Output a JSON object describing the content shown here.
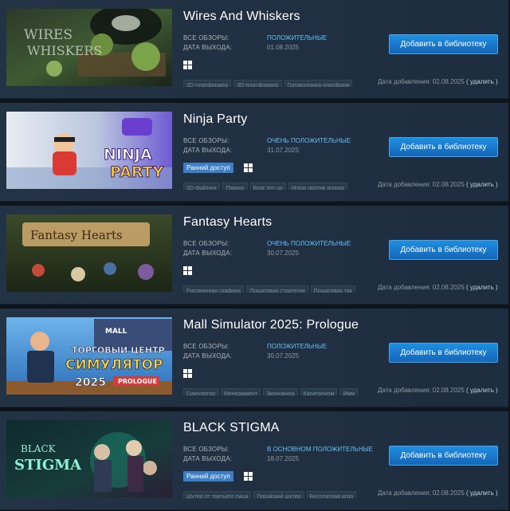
{
  "labels": {
    "reviews": "ВСЕ ОБЗОРЫ:",
    "release": "ДАТА ВЫХОДА:",
    "add_button": "Добавить в библиотеку",
    "date_added_prefix": "Дата добавления:",
    "remove": "( удалить )"
  },
  "colors": {
    "accent": "#66c0f4",
    "button": "#1a7ed3",
    "early_access": "#3d7fc4",
    "row_bg": "#1f2f42"
  },
  "items": [
    {
      "title": "Wires And Whiskers",
      "reviews": "ПОЛОЖИТЕЛЬНЫЕ",
      "release": "01.08.2025",
      "early_access": "",
      "platform_icon": "windows-icon",
      "tags": [
        "2D-платформер",
        "3D-платформер",
        "Головоломка-платформ"
      ],
      "date_added": "02.08.2025",
      "capsule_text": [
        "WIRES",
        "WHISKERS"
      ]
    },
    {
      "title": "Ninja Party",
      "reviews": "ОЧЕНЬ ПОЛОЖИТЕЛЬНЫЕ",
      "release": "31.07.2025",
      "early_access": "Ранний доступ",
      "platform_icon": "windows-icon",
      "tags": [
        "3D-файтинг",
        "Паркур",
        "Beat 'em up",
        "Игрок против игрока"
      ],
      "date_added": "02.08.2025",
      "capsule_text": [
        "NINJA",
        "PARTY"
      ]
    },
    {
      "title": "Fantasy Hearts",
      "reviews": "ОЧЕНЬ ПОЛОЖИТЕЛЬНЫЕ",
      "release": "30.07.2025",
      "early_access": "",
      "platform_icon": "windows-icon",
      "tags": [
        "Рисованная графика",
        "Пошаговая стратегия",
        "Пошаговая так"
      ],
      "date_added": "02.08.2025",
      "capsule_text": [
        "Fantasy Hearts"
      ]
    },
    {
      "title": "Mall Simulator 2025: Prologue",
      "reviews": "ПОЛОЖИТЕЛЬНЫЕ",
      "release": "30.07.2025",
      "early_access": "",
      "platform_icon": "windows-icon",
      "tags": [
        "Симулятор",
        "Менеджмент",
        "Экономика",
        "Капитализм",
        "Имм"
      ],
      "date_added": "02.08.2025",
      "capsule_text": [
        "MALL",
        "ТОРГОВЫЙ ЦЕНТР",
        "СИМУЛЯТОР",
        "2025",
        "PROLOGUE"
      ]
    },
    {
      "title": "BLACK STIGMA",
      "reviews": "В ОСНОВНОМ ПОЛОЖИТЕЛЬНЫЕ",
      "release": "18.07.2025",
      "early_access": "Ранний доступ",
      "platform_icon": "windows-icon",
      "tags": [
        "Шутер от третьего лица",
        "Геройский шутер",
        "Бесплатная игра"
      ],
      "date_added": "02.08.2025",
      "capsule_text": [
        "BLACK",
        "STIGMA"
      ]
    }
  ]
}
